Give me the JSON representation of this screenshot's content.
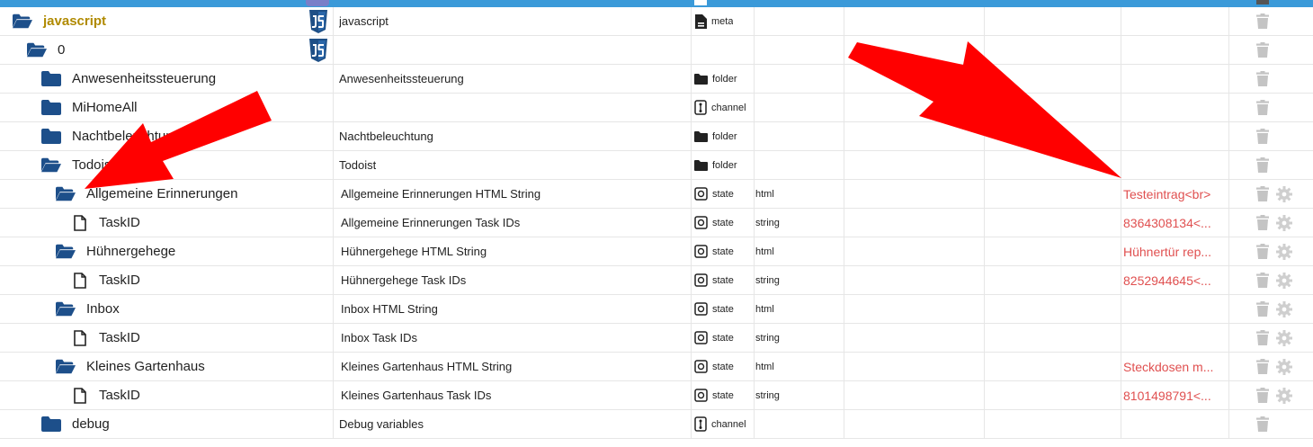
{
  "colors": {
    "header_bar": "#3b9ad9",
    "root_name": "#b08a00",
    "value_text": "#e05050",
    "folder_icon": "#1d4f8a",
    "arrow": "#ff0000"
  },
  "rows": [
    {
      "name": "javascript",
      "indent": 14,
      "icon": "folder-open",
      "root": true,
      "js": true,
      "desc": "javascript",
      "type": "meta",
      "typeIcon": "file-icon",
      "role": "",
      "value": "",
      "gear": false
    },
    {
      "name": "0",
      "indent": 30,
      "icon": "folder-open",
      "js": true,
      "desc": "",
      "type": "",
      "typeIcon": "",
      "role": "",
      "value": "",
      "gear": false
    },
    {
      "name": "Anwesenheitssteuerung",
      "indent": 46,
      "icon": "folder",
      "desc": "Anwesenheitssteuerung",
      "type": "folder",
      "typeIcon": "folder-icon",
      "role": "",
      "value": "",
      "gear": false
    },
    {
      "name": "MiHomeAll",
      "indent": 46,
      "icon": "folder",
      "desc": "",
      "type": "channel",
      "typeIcon": "channel-icon",
      "role": "",
      "value": "",
      "gear": false
    },
    {
      "name": "Nachtbeleuchtung",
      "indent": 46,
      "icon": "folder",
      "desc": "Nachtbeleuchtung",
      "type": "folder",
      "typeIcon": "folder-icon",
      "role": "",
      "value": "",
      "gear": false
    },
    {
      "name": "Todoist",
      "indent": 46,
      "icon": "folder-open",
      "desc": "Todoist",
      "type": "folder",
      "typeIcon": "folder-icon",
      "role": "",
      "value": "",
      "gear": false
    },
    {
      "name": "Allgemeine Erinnerungen",
      "indent": 62,
      "icon": "folder-open",
      "desc": "Allgemeine Erinnerungen HTML String",
      "type": "state",
      "typeIcon": "state-icon",
      "role": "html",
      "value": "Testeintrag<br>",
      "gear": true
    },
    {
      "name": "TaskID",
      "indent": 82,
      "icon": "file",
      "desc": "Allgemeine Erinnerungen Task IDs",
      "type": "state",
      "typeIcon": "state-icon",
      "role": "string",
      "value": "8364308134<...",
      "gear": true
    },
    {
      "name": "Hühnergehege",
      "indent": 62,
      "icon": "folder-open",
      "desc": "Hühnergehege HTML String",
      "type": "state",
      "typeIcon": "state-icon",
      "role": "html",
      "value": "Hühnertür rep...",
      "gear": true
    },
    {
      "name": "TaskID",
      "indent": 82,
      "icon": "file",
      "desc": "Hühnergehege Task IDs",
      "type": "state",
      "typeIcon": "state-icon",
      "role": "string",
      "value": "8252944645<...",
      "gear": true
    },
    {
      "name": "Inbox",
      "indent": 62,
      "icon": "folder-open",
      "desc": "Inbox HTML String",
      "type": "state",
      "typeIcon": "state-icon",
      "role": "html",
      "value": "",
      "gear": true
    },
    {
      "name": "TaskID",
      "indent": 82,
      "icon": "file",
      "desc": "Inbox Task IDs",
      "type": "state",
      "typeIcon": "state-icon",
      "role": "string",
      "value": "",
      "gear": true
    },
    {
      "name": "Kleines Gartenhaus",
      "indent": 62,
      "icon": "folder-open",
      "desc": "Kleines Gartenhaus HTML String",
      "type": "state",
      "typeIcon": "state-icon",
      "role": "html",
      "value": "Steckdosen m...",
      "gear": true
    },
    {
      "name": "TaskID",
      "indent": 82,
      "icon": "file",
      "desc": "Kleines Gartenhaus Task IDs",
      "type": "state",
      "typeIcon": "state-icon",
      "role": "string",
      "value": "8101498791<...",
      "gear": true
    },
    {
      "name": "debug",
      "indent": 46,
      "icon": "folder",
      "desc": "Debug variables",
      "type": "channel",
      "typeIcon": "channel-icon",
      "role": "",
      "value": "",
      "gear": false
    }
  ]
}
